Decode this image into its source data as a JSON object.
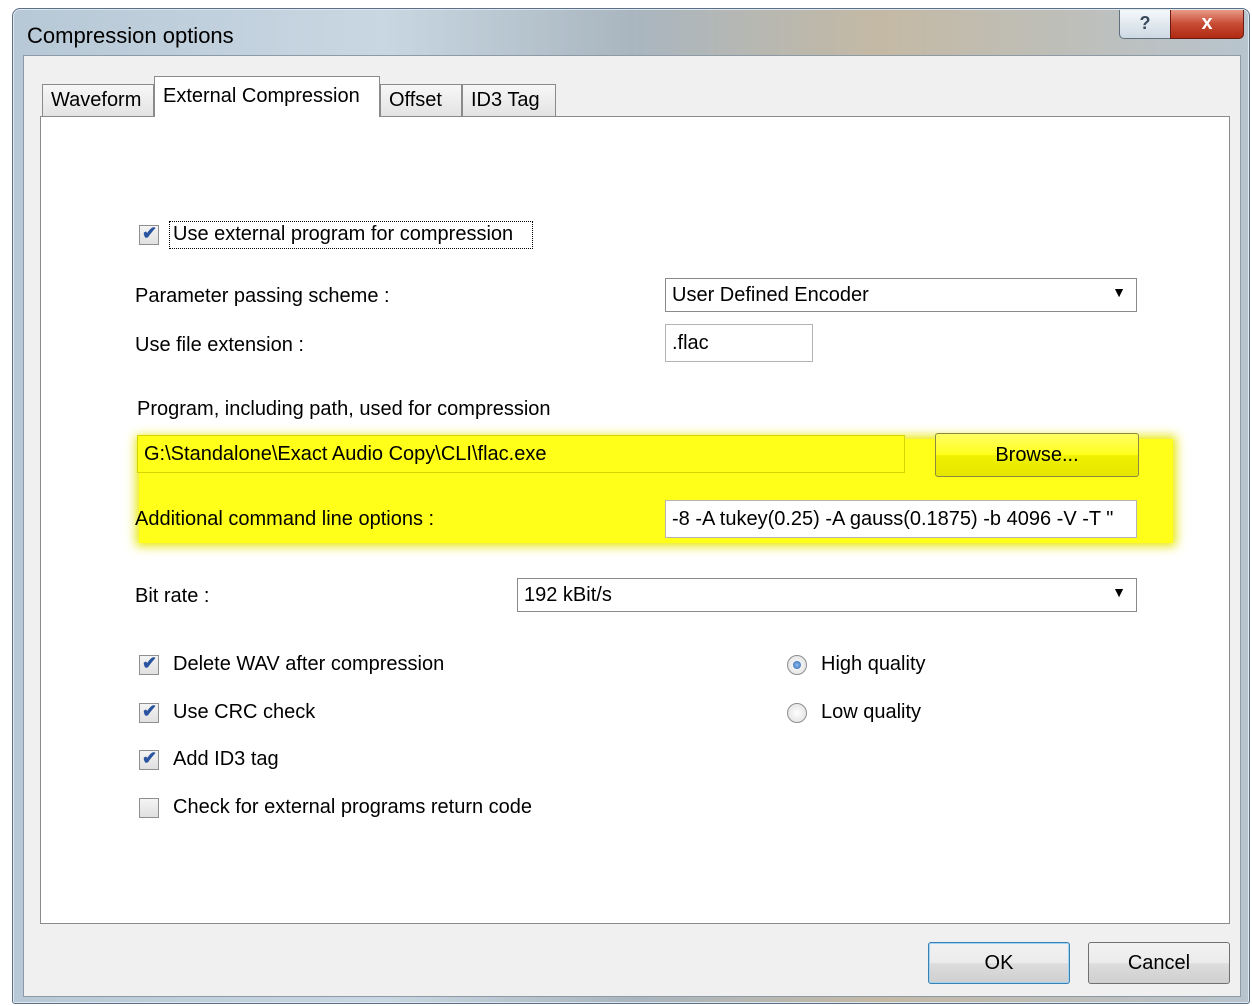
{
  "window": {
    "title": "Compression options",
    "help_label": "?",
    "close_label": "x"
  },
  "tabs": [
    {
      "label": "Waveform",
      "active": false
    },
    {
      "label": "External Compression",
      "active": true
    },
    {
      "label": "Offset",
      "active": false
    },
    {
      "label": "ID3 Tag",
      "active": false
    }
  ],
  "external": {
    "use_external": {
      "label": "Use external program for compression",
      "checked": true
    },
    "scheme": {
      "label": "Parameter passing scheme :",
      "value": "User Defined Encoder"
    },
    "extension": {
      "label": "Use file extension :",
      "value": ".flac"
    },
    "program": {
      "label": "Program, including path, used for compression",
      "value": "G:\\Standalone\\Exact Audio Copy\\CLI\\flac.exe",
      "browse_label": "Browse..."
    },
    "options": {
      "label": "Additional command line options :",
      "value": "-8 -A tukey(0.25) -A gauss(0.1875) -b 4096 -V -T \""
    },
    "bitrate": {
      "label": "Bit rate :",
      "value": "192 kBit/s"
    },
    "checks": [
      {
        "label": "Delete WAV after compression",
        "checked": true
      },
      {
        "label": "Use CRC check",
        "checked": true
      },
      {
        "label": "Add ID3 tag",
        "checked": true
      },
      {
        "label": "Check for external programs return code",
        "checked": false
      }
    ],
    "quality": [
      {
        "label": "High quality",
        "selected": true
      },
      {
        "label": "Low quality",
        "selected": false
      }
    ]
  },
  "buttons": {
    "ok": "OK",
    "cancel": "Cancel"
  },
  "colors": {
    "highlight": "#ffff1a",
    "checkmark": "#2a54a0"
  }
}
